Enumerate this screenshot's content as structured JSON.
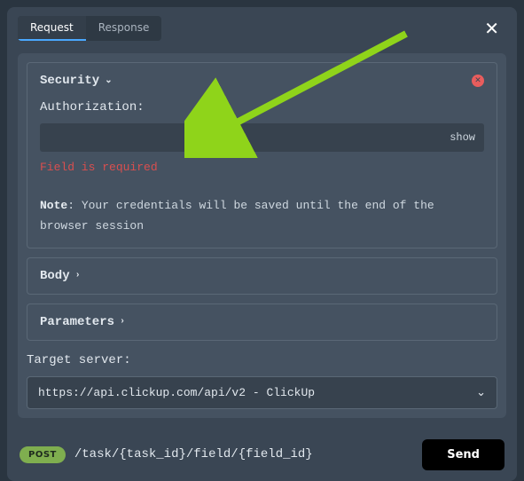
{
  "tabs": {
    "request": "Request",
    "response": "Response"
  },
  "security": {
    "title": "Security",
    "auth_label": "Authorization:",
    "show_label": "show",
    "error": "Field is required",
    "note_prefix": "Note",
    "note_text": ": Your credentials will be saved until the end of the browser session"
  },
  "body": {
    "title": "Body"
  },
  "parameters": {
    "title": "Parameters"
  },
  "target": {
    "label": "Target server:",
    "value": "https://api.clickup.com/api/v2 - ClickUp"
  },
  "request": {
    "method": "POST",
    "path": "/task/{task_id}/field/{field_id}",
    "send": "Send"
  }
}
